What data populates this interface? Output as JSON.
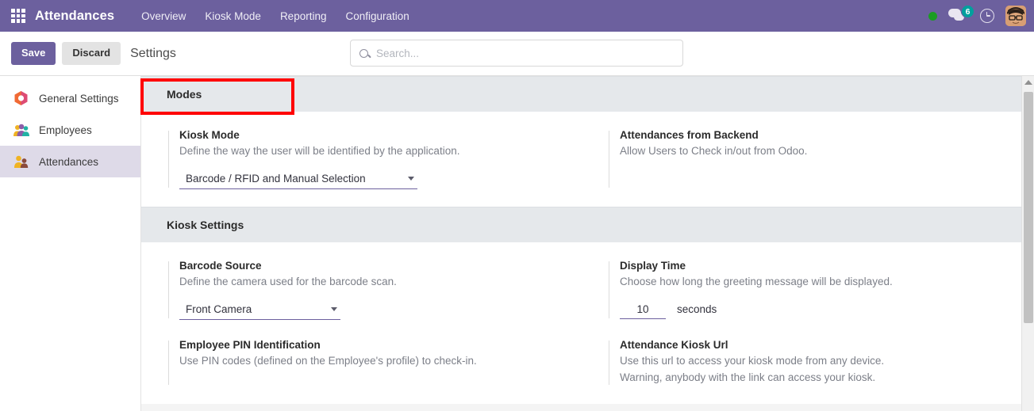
{
  "navbar": {
    "apps_icon": "apps-grid-icon",
    "brand": "Attendances",
    "menu": [
      {
        "label": "Overview"
      },
      {
        "label": "Kiosk Mode"
      },
      {
        "label": "Reporting"
      },
      {
        "label": "Configuration"
      }
    ],
    "tray": {
      "status_dot": "online-status-dot",
      "messages_icon": "messages-icon",
      "messages_count": "6",
      "activity_icon": "clock-icon",
      "avatar": "user-avatar"
    },
    "colors": {
      "navbar_bg": "#6C609E",
      "badge_bg": "#00A09D",
      "status_dot": "#1A9C22"
    }
  },
  "control_panel": {
    "save_label": "Save",
    "discard_label": "Discard",
    "breadcrumb": "Settings"
  },
  "search": {
    "icon": "search-icon",
    "placeholder": "Search...",
    "value": ""
  },
  "sidebar": {
    "items": [
      {
        "label": "General Settings",
        "icon": "settings-hexagon-icon",
        "active": false
      },
      {
        "label": "Employees",
        "icon": "employees-icon",
        "active": false
      },
      {
        "label": "Attendances",
        "icon": "attendances-icon",
        "active": true
      }
    ],
    "active_bg": "#DEDAE8"
  },
  "sections": {
    "modes": {
      "title": "Modes",
      "kiosk_mode": {
        "label": "Kiosk Mode",
        "help": "Define the way the user will be identified by the application.",
        "selected": "Barcode / RFID and Manual Selection"
      },
      "attendances_backend": {
        "label": "Attendances from Backend",
        "help": "Allow Users to Check in/out from Odoo.",
        "checked": true
      }
    },
    "kiosk_settings": {
      "title": "Kiosk Settings",
      "barcode_source": {
        "label": "Barcode Source",
        "help": "Define the camera used for the barcode scan.",
        "selected": "Front Camera"
      },
      "display_time": {
        "label": "Display Time",
        "help": "Choose how long the greeting message will be displayed.",
        "value": "10",
        "unit": "seconds"
      },
      "employee_pin": {
        "label": "Employee PIN Identification",
        "help": "Use PIN codes (defined on the Employee's profile) to check-in.",
        "checked": true
      },
      "kiosk_url": {
        "label": "Attendance Kiosk Url",
        "help_line1": "Use this url to access your kiosk mode from any device.",
        "help_line2": "Warning, anybody with the link can access your kiosk."
      }
    }
  },
  "annotation": {
    "target": "Modes",
    "color": "#FF0000"
  },
  "scrollbar": {
    "orientation": "vertical"
  }
}
